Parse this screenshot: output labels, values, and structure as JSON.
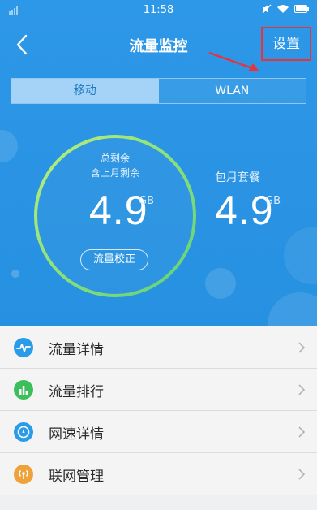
{
  "status_bar": {
    "time": "11:58"
  },
  "nav": {
    "title": "流量监控",
    "settings_label": "设置"
  },
  "tabs": [
    {
      "label": "移动",
      "active": true
    },
    {
      "label": "WLAN",
      "active": false
    }
  ],
  "remaining": {
    "label_line1": "总剩余",
    "label_line2": "含上月剩余",
    "value": "4.9",
    "unit": "GB",
    "calibrate_label": "流量校正"
  },
  "monthly": {
    "label": "包月套餐",
    "value": "4.9",
    "unit": "GB"
  },
  "list": [
    {
      "label": "流量详情",
      "icon": "pulse-icon",
      "color": "#2a9be8"
    },
    {
      "label": "流量排行",
      "icon": "bar-chart-icon",
      "color": "#3cbf5b"
    },
    {
      "label": "网速详情",
      "icon": "speed-icon",
      "color": "#2a9be8"
    },
    {
      "label": "联网管理",
      "icon": "broadcast-icon",
      "color": "#f0a23a"
    }
  ],
  "colors": {
    "hero_blue": "#2a93e3",
    "ring_green": "#8de06a",
    "annotation_red": "#e8323c"
  }
}
